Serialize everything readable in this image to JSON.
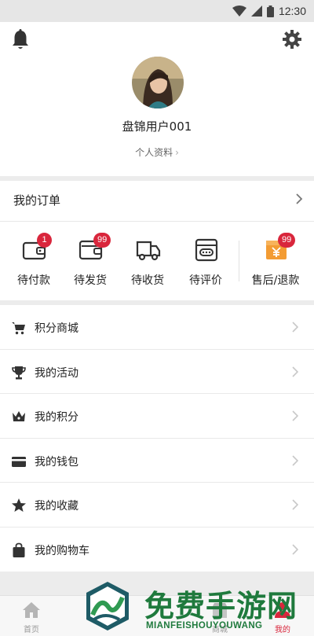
{
  "status_bar": {
    "time": "12:30",
    "icons": [
      "wifi-icon",
      "signal-icon",
      "battery-icon"
    ]
  },
  "header": {
    "notification_icon": "bell-icon",
    "settings_icon": "gear-icon",
    "username": "盘锦用户001",
    "profile_link": "个人资料",
    "profile_chevron": "›"
  },
  "orders": {
    "title": "我的订单",
    "items": [
      {
        "label": "待付款",
        "icon": "wallet-icon",
        "badge": "1"
      },
      {
        "label": "待发货",
        "icon": "card-wallet-icon",
        "badge": "99"
      },
      {
        "label": "待收货",
        "icon": "truck-icon",
        "badge": ""
      },
      {
        "label": "待评价",
        "icon": "comment-box-icon",
        "badge": ""
      },
      {
        "label": "售后/退款",
        "icon": "refund-icon",
        "badge": "99"
      }
    ]
  },
  "menu": {
    "items": [
      {
        "label": "积分商城",
        "icon": "cart-icon"
      },
      {
        "label": "我的活动",
        "icon": "trophy-icon"
      },
      {
        "label": "我的积分",
        "icon": "crown-icon"
      },
      {
        "label": "我的钱包",
        "icon": "card-icon"
      },
      {
        "label": "我的收藏",
        "icon": "star-icon"
      },
      {
        "label": "我的购物车",
        "icon": "shopping-bag-icon"
      }
    ]
  },
  "tabbar": {
    "tabs": [
      {
        "label": "首页",
        "icon": "home-icon",
        "active": false
      },
      {
        "label": "",
        "icon": "",
        "active": false
      },
      {
        "label": "",
        "icon": "",
        "active": false
      },
      {
        "label": "商城",
        "icon": "store-icon",
        "active": false
      },
      {
        "label": "我的",
        "icon": "profile-icon",
        "active": true
      }
    ]
  },
  "watermark": {
    "text": "免费手游网",
    "subtext": "MIANFEISHOUYOUWANG"
  },
  "colors": {
    "accent": "#d9263c",
    "badge": "#d9263c",
    "refund_orange": "#f39c33",
    "watermark_green": "#1f7a3d"
  }
}
